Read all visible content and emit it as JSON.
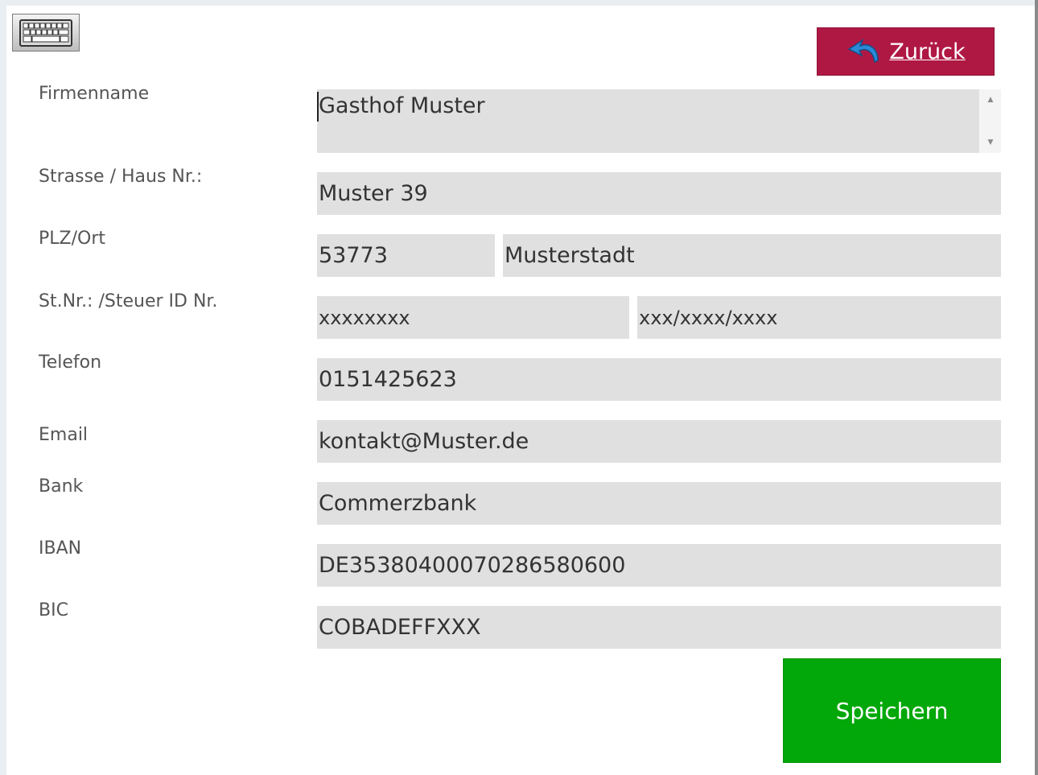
{
  "toolbar": {
    "keyboard_icon": "keyboard-icon",
    "back_label": "Zurück",
    "back_icon": "undo-arrow-icon",
    "back_color": "#b01844"
  },
  "form": {
    "company": {
      "label": "Firmenname",
      "value": "Gasthof Muster"
    },
    "street": {
      "label": "Strasse / Haus Nr.:",
      "value": "Muster 39"
    },
    "plz_ort": {
      "label": "PLZ/Ort",
      "plz": "53773",
      "ort": "Musterstadt"
    },
    "tax": {
      "label": "St.Nr.: /Steuer ID Nr.",
      "st_nr": "xxxxxxxx",
      "steuer_id": "xxx/xxxx/xxxx"
    },
    "phone": {
      "label": "Telefon",
      "value": "0151425623"
    },
    "email": {
      "label": "Email",
      "value": "kontakt@Muster.de"
    },
    "bank": {
      "label": "Bank",
      "value": "Commerzbank"
    },
    "iban": {
      "label": "IBAN",
      "value": "DE35380400070286580600"
    },
    "bic": {
      "label": "BIC",
      "value": "COBADEFFXXX"
    }
  },
  "actions": {
    "save_label": "Speichern",
    "save_color": "#02a809"
  }
}
